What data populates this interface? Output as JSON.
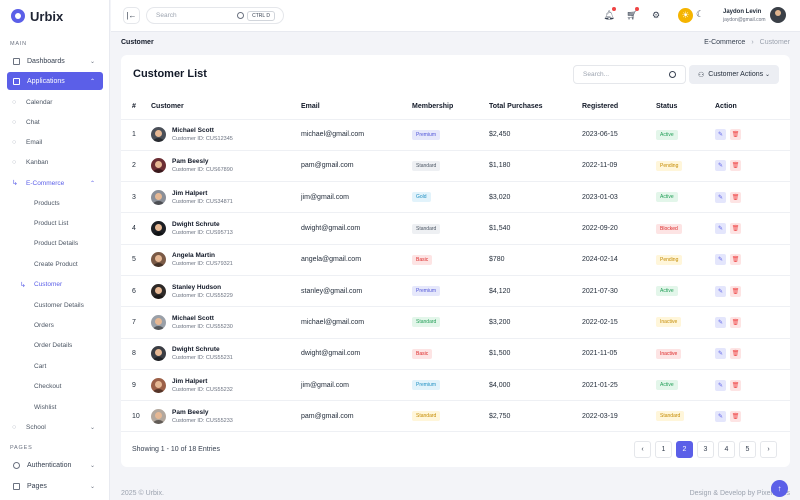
{
  "brand": {
    "name": "Urbix"
  },
  "sidebar": {
    "main_label": "MAIN",
    "pages_label": "PAGES",
    "items": [
      {
        "label": "Dashboards",
        "icon": "grid-icon"
      },
      {
        "label": "Applications",
        "icon": "apps-icon"
      },
      {
        "label": "Authentication",
        "icon": "user-icon"
      },
      {
        "label": "Pages",
        "icon": "file-icon"
      }
    ],
    "app_sub": [
      "Calendar",
      "Chat",
      "Email",
      "Kanban"
    ],
    "ecommerce": {
      "label": "E-Commerce"
    },
    "ecommerce_sub": [
      "Products",
      "Product List",
      "Product Details",
      "Create Product",
      "Customer",
      "Customer Details",
      "Orders",
      "Order Details",
      "Cart",
      "Checkout",
      "Wishlist"
    ],
    "school": {
      "label": "School"
    }
  },
  "header": {
    "toggle": "|←",
    "search_placeholder": "Search",
    "search_shortcut": "CTRL D",
    "user_name": "Jaydon Levin",
    "user_email": "jaydon@gmail.com"
  },
  "breadcrumb": {
    "title": "Customer",
    "parent": "E-Commerce",
    "current": "Customer"
  },
  "card": {
    "title": "Customer List",
    "search_placeholder": "Search...",
    "actions_label": "Customer Actions"
  },
  "table": {
    "columns": [
      "#",
      "Customer",
      "Email",
      "Membership",
      "Total Purchases",
      "Registered",
      "Status",
      "Action"
    ],
    "rows": [
      {
        "n": "1",
        "name": "Michael Scott",
        "cid": "Customer ID: CUS12345",
        "email": "michael@gmail.com",
        "membership": "Premium",
        "total": "$2,450",
        "registered": "2023-06-15",
        "status": "Active",
        "avatar_color": "#4a4f58"
      },
      {
        "n": "2",
        "name": "Pam Beesly",
        "cid": "Customer ID: CUS67890",
        "email": "pam@gmail.com",
        "membership": "Standard",
        "total": "$1,180",
        "registered": "2022-11-09",
        "status": "Pending",
        "avatar_color": "#6b2e34"
      },
      {
        "n": "3",
        "name": "Jim Halpert",
        "cid": "Customer ID: CUS34871",
        "email": "jim@gmail.com",
        "membership": "Gold",
        "total": "$3,020",
        "registered": "2023-01-03",
        "status": "Active",
        "avatar_color": "#8a8f98"
      },
      {
        "n": "4",
        "name": "Dwight Schrute",
        "cid": "Customer ID: CUS95713",
        "email": "dwight@gmail.com",
        "membership": "Standard",
        "total": "$1,540",
        "registered": "2022-09-20",
        "status": "Blocked",
        "avatar_color": "#1d1f24"
      },
      {
        "n": "5",
        "name": "Angela Martin",
        "cid": "Customer ID: CUS79321",
        "email": "angela@gmail.com",
        "membership": "Basic",
        "total": "$780",
        "registered": "2024-02-14",
        "status": "Pending",
        "avatar_color": "#7a5a46"
      },
      {
        "n": "6",
        "name": "Stanley Hudson",
        "cid": "Customer ID: CUS55229",
        "email": "stanley@gmail.com",
        "membership": "Premium",
        "total": "$4,120",
        "registered": "2021-07-30",
        "status": "Active",
        "avatar_color": "#2e2a28"
      },
      {
        "n": "7",
        "name": "Michael Scott",
        "cid": "Customer ID: CUS55230",
        "email": "michael@gmail.com",
        "membership": "Standard",
        "total": "$3,200",
        "registered": "2022-02-15",
        "status": "Inactive",
        "avatar_color": "#9aa0a8"
      },
      {
        "n": "8",
        "name": "Dwight Schrute",
        "cid": "Customer ID: CUS55231",
        "email": "dwight@gmail.com",
        "membership": "Basic",
        "total": "$1,500",
        "registered": "2021-11-05",
        "status": "Inactive",
        "avatar_color": "#3a3d44"
      },
      {
        "n": "9",
        "name": "Jim Halpert",
        "cid": "Customer ID: CUS55232",
        "email": "jim@gmail.com",
        "membership": "Premium",
        "total": "$4,000",
        "registered": "2021-01-25",
        "status": "Active",
        "avatar_color": "#9c6048"
      },
      {
        "n": "10",
        "name": "Pam Beesly",
        "cid": "Customer ID: CUS55233",
        "email": "pam@gmail.com",
        "membership": "Standard",
        "total": "$2,750",
        "registered": "2022-03-19",
        "status": "Standard",
        "avatar_color": "#b3a89e"
      }
    ]
  },
  "pill_styles": {
    "Premium": {
      "bg": "#e6e8fb",
      "fg": "#4f54d8"
    },
    "Standard": {
      "bg": "#eef0f3",
      "fg": "#4b5563"
    },
    "Gold": {
      "bg": "#e2f3fb",
      "fg": "#1f8fc2"
    },
    "Basic": {
      "bg": "#fff6da",
      "fg": "#c48a00"
    },
    "Active": {
      "bg": "#e3f6ea",
      "fg": "#1f9d55"
    },
    "Pending": {
      "bg": "#fff6da",
      "fg": "#c48a00"
    },
    "Blocked": {
      "bg": "#fde4e4",
      "fg": "#dc2626"
    },
    "Inactive": {
      "bg": "#fff6da",
      "fg": "#c48a00"
    }
  },
  "member_pill_styles": {
    "Standard": {
      "bg": "#eef0f3",
      "fg": "#4b5563"
    },
    "Basic": {
      "bg": "#fde4e4",
      "fg": "#dc2626"
    }
  },
  "row_overrides": {
    "7": {
      "membership": {
        "bg": "#e3f6ea",
        "fg": "#1f9d55"
      }
    },
    "8": {
      "status": {
        "bg": "#fde4e4",
        "fg": "#dc2626"
      }
    },
    "9": {
      "membership": {
        "bg": "#e2f3fb",
        "fg": "#1f8fc2"
      }
    },
    "10": {
      "membership": {
        "bg": "#fff6da",
        "fg": "#c48a00"
      },
      "status": {
        "bg": "#fff6da",
        "fg": "#c48a00"
      }
    }
  },
  "pagination": {
    "showing": "Showing 1 - 10 of 18 Entries",
    "prev": "‹",
    "next": "›",
    "pages": [
      "1",
      "2",
      "3",
      "4",
      "5"
    ],
    "current": "2"
  },
  "footer": {
    "left": "2025 © Urbix.",
    "right": "Design & Develop by Pixelwibes"
  },
  "colors": {
    "accent": "#5b5fe8"
  }
}
